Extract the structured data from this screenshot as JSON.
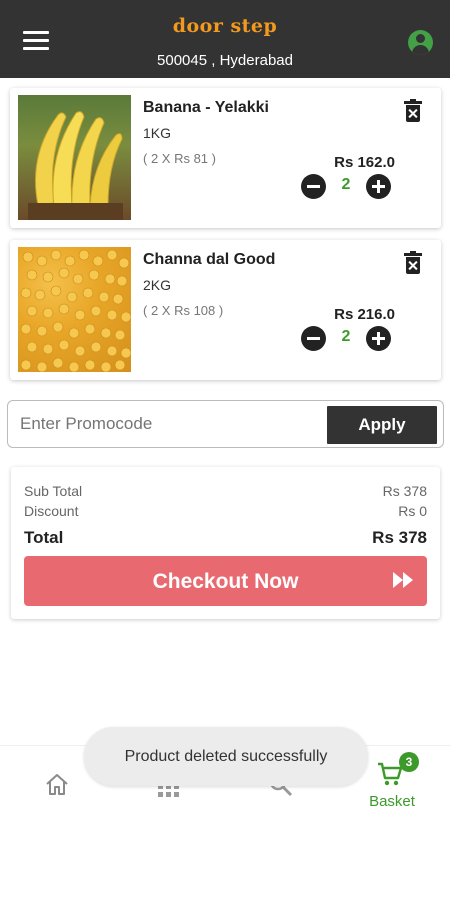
{
  "header": {
    "brand": "door step",
    "location": "500045 , Hyderabad"
  },
  "cart": {
    "items": [
      {
        "name": "Banana - Yelakki",
        "quantity_label": "1KG",
        "unit_price": "( 2 X Rs 81 )",
        "price": "Rs 162.0",
        "count": "2"
      },
      {
        "name": "Channa dal Good",
        "quantity_label": "2KG",
        "unit_price": "( 2 X Rs 108 )",
        "price": "Rs 216.0",
        "count": "2"
      }
    ]
  },
  "promo": {
    "placeholder": "Enter Promocode",
    "apply_label": "Apply"
  },
  "summary": {
    "subtotal_label": "Sub Total",
    "subtotal_value": "Rs 378",
    "discount_label": "Discount",
    "discount_value": "Rs 0",
    "total_label": "Total",
    "total_value": "Rs 378",
    "checkout_label": "Checkout Now"
  },
  "bottom_nav": {
    "basket_label": "Basket",
    "basket_count": "3"
  },
  "toast": {
    "message": "Product deleted successfully"
  },
  "colors": {
    "header_bg": "#333333",
    "accent_green": "#3c9a2a",
    "checkout_bg": "#e86a70",
    "brand_orange": "#f39a1e"
  },
  "icons": [
    "menu-icon",
    "profile-icon",
    "trash-icon",
    "minus-icon",
    "plus-icon",
    "fast-forward-icon",
    "home-icon",
    "grid-icon",
    "search-icon",
    "cart-icon"
  ]
}
